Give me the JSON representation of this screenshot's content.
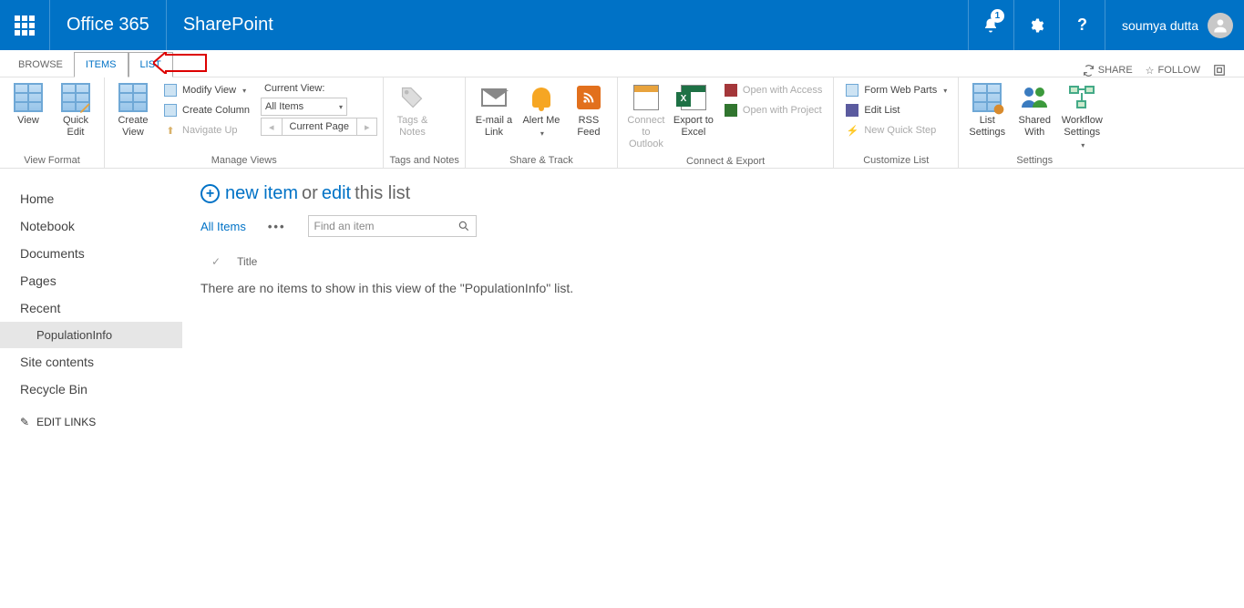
{
  "suitebar": {
    "brand": "Office 365",
    "app": "SharePoint",
    "notifications": "1",
    "username": "soumya dutta"
  },
  "tabs": {
    "browse": "BROWSE",
    "items": "ITEMS",
    "list": "LIST",
    "share": "SHARE",
    "follow": "FOLLOW"
  },
  "ribbon": {
    "view": "View",
    "quick_edit": "Quick Edit",
    "view_format": "View Format",
    "create_view": "Create View",
    "modify_view": "Modify View",
    "create_column": "Create Column",
    "navigate_up": "Navigate Up",
    "current_view": "Current View:",
    "all_items_sel": "All Items",
    "current_page": "Current Page",
    "manage_views": "Manage Views",
    "tags_notes": "Tags & Notes",
    "tags_and_notes": "Tags and Notes",
    "email_link": "E-mail a Link",
    "alert_me": "Alert Me",
    "rss_feed": "RSS Feed",
    "share_track": "Share & Track",
    "connect_outlook": "Connect to Outlook",
    "export_excel": "Export to Excel",
    "open_access": "Open with Access",
    "open_project": "Open with Project",
    "connect_export": "Connect & Export",
    "form_web_parts": "Form Web Parts",
    "edit_list": "Edit List",
    "new_quick_step": "New Quick Step",
    "customize_list": "Customize List",
    "list_settings": "List Settings",
    "shared_with": "Shared With",
    "workflow_settings": "Workflow Settings",
    "settings": "Settings"
  },
  "nav": {
    "home": "Home",
    "notebook": "Notebook",
    "documents": "Documents",
    "pages": "Pages",
    "recent": "Recent",
    "populationinfo": "PopulationInfo",
    "site_contents": "Site contents",
    "recycle_bin": "Recycle Bin",
    "edit_links": "EDIT LINKS"
  },
  "content": {
    "new_item": "new item",
    "or": "or",
    "edit": "edit",
    "this_list": "this list",
    "all_items": "All Items",
    "find_placeholder": "Find an item",
    "title": "Title",
    "empty": "There are no items to show in this view of the \"PopulationInfo\" list."
  }
}
